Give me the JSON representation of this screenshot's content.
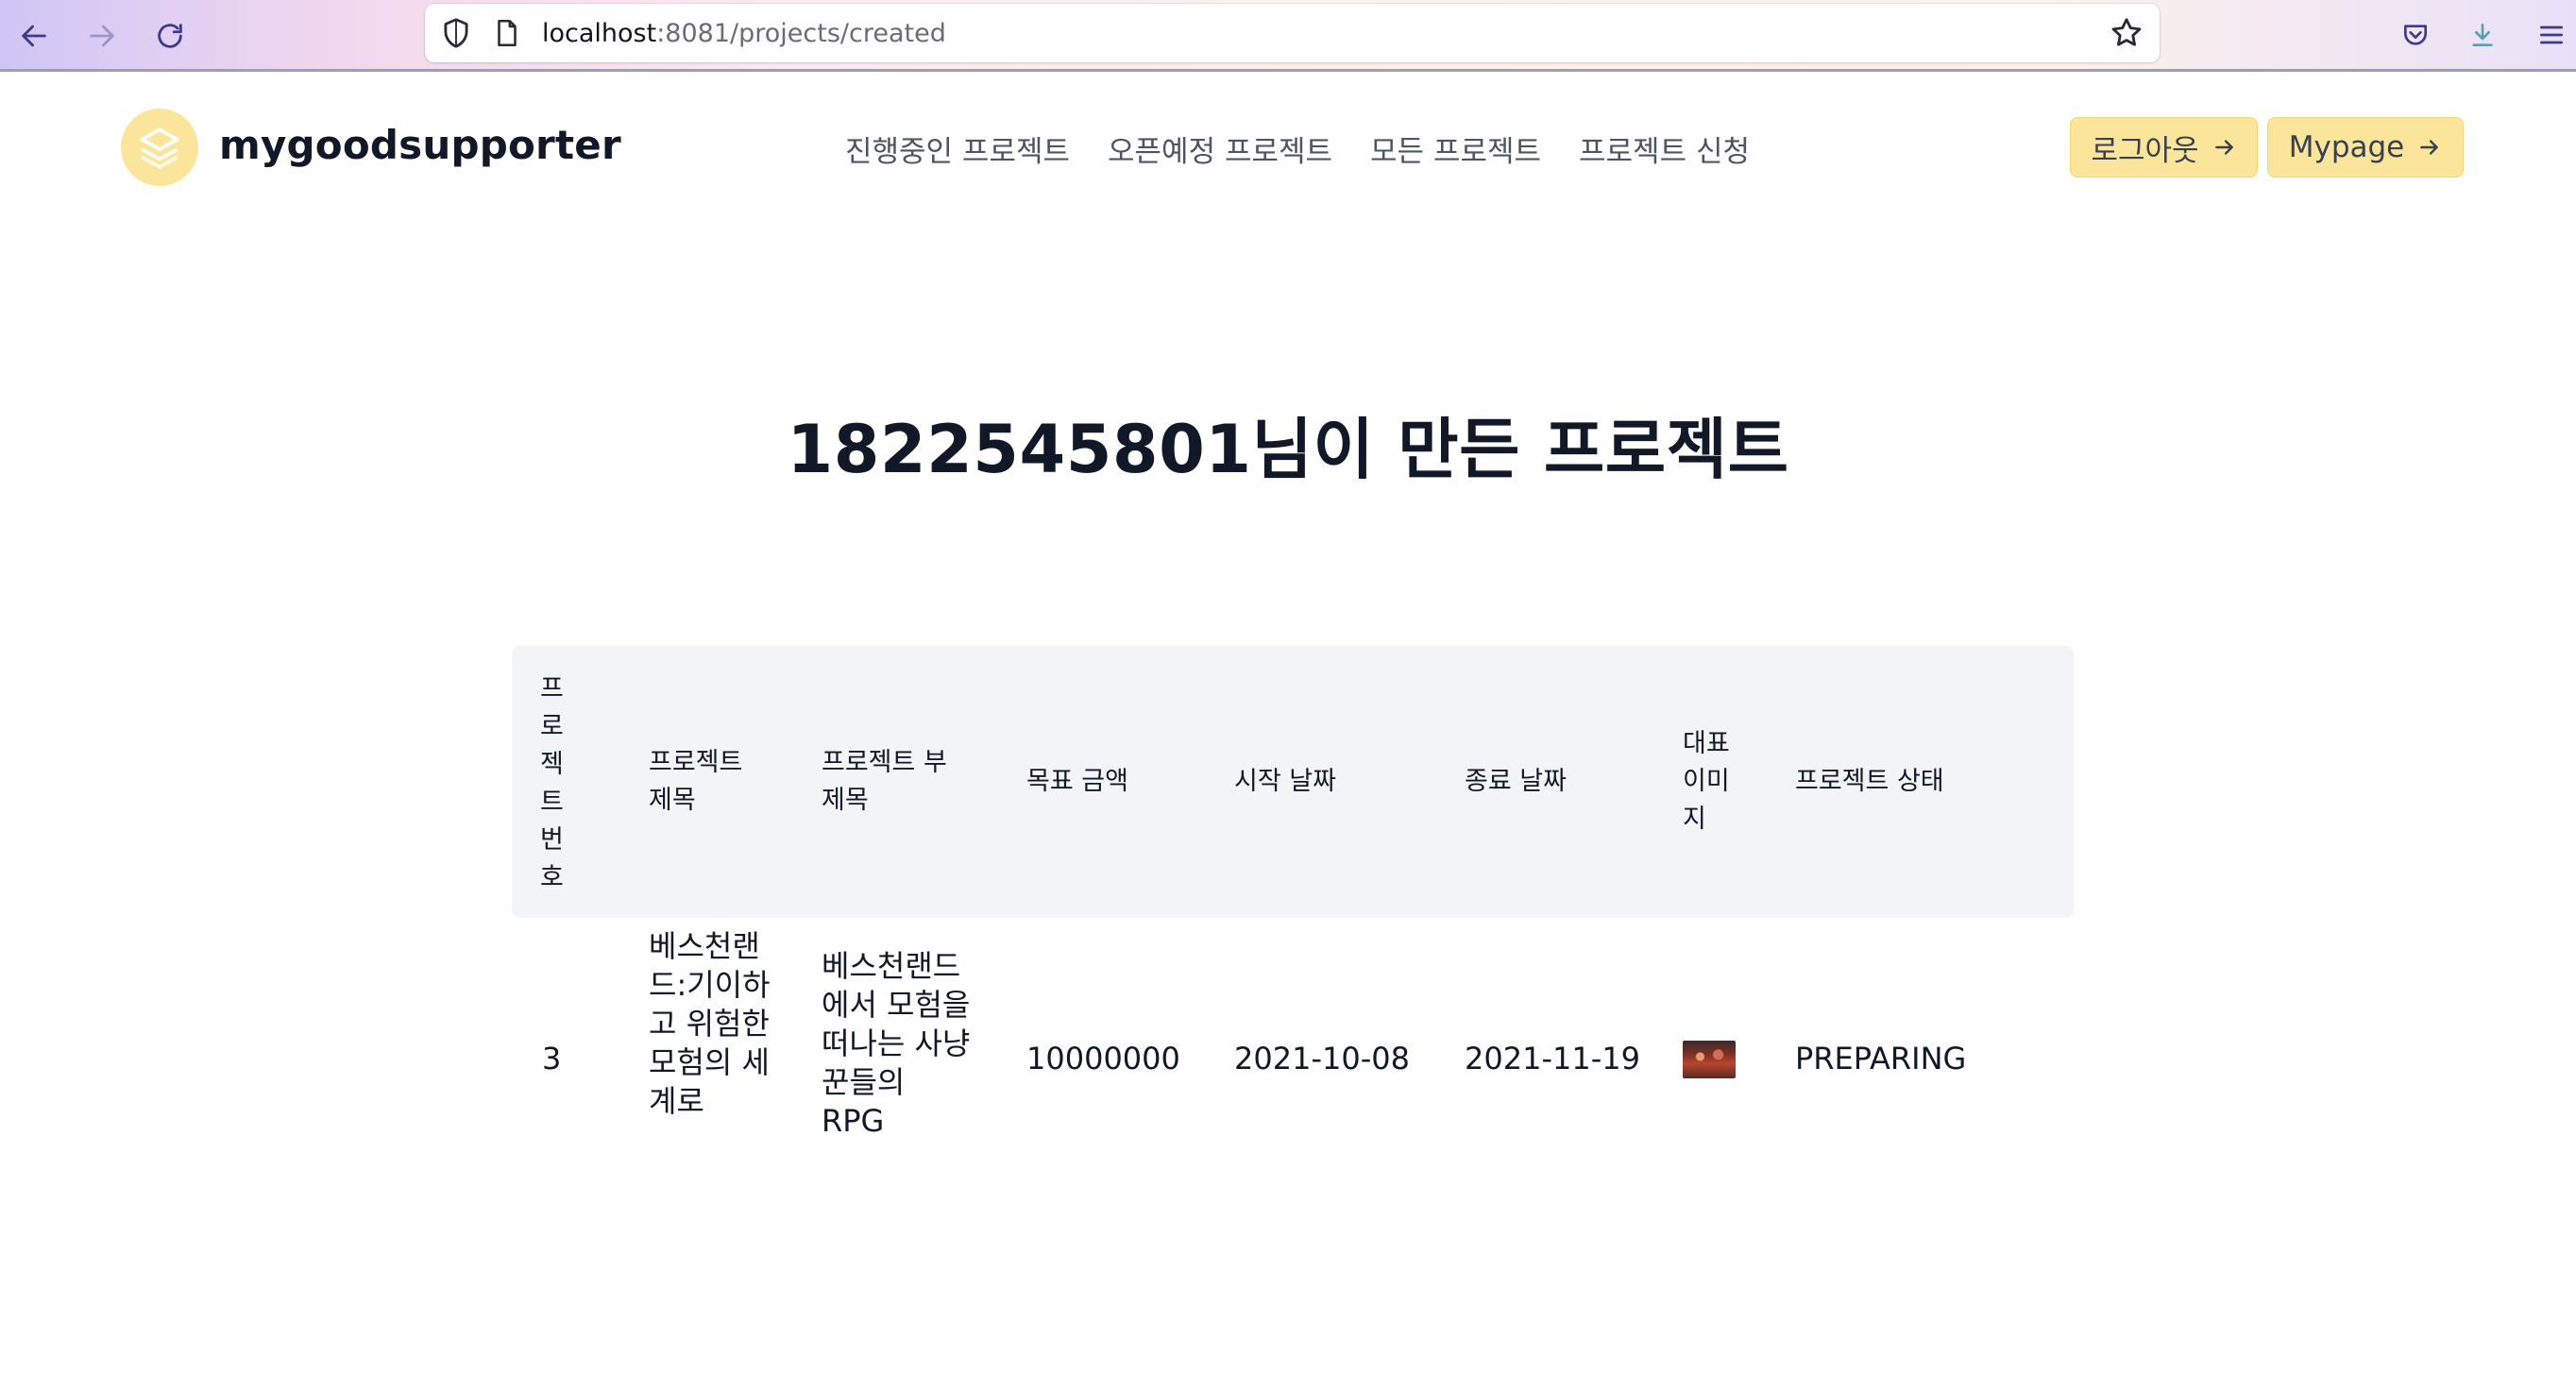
{
  "browser": {
    "url_host": "localhost",
    "url_path": ":8081/projects/created"
  },
  "header": {
    "brand": "mygoodsupporter",
    "nav": [
      "진행중인 프로젝트",
      "오픈예정 프로젝트",
      "모든 프로젝트",
      "프로젝트 신청"
    ],
    "logout_label": "로그아웃",
    "mypage_label": "Mypage"
  },
  "main": {
    "title": "1822545801님이 만든 프로젝트",
    "columns": {
      "number": "프로젝트번호",
      "title": "프로젝트 제목",
      "subtitle": "프로젝트 부 제목",
      "goal": "목표 금액",
      "start": "시작 날짜",
      "end": "종료 날짜",
      "image": "대표 이미지",
      "status": "프로젝트 상태"
    },
    "rows": [
      {
        "number": "3",
        "title": "베스천랜드:기이하고 위험한 모험의 세계로",
        "subtitle": "베스천랜드에서 모험을 떠나는 사냥꾼들의 RPG",
        "goal": "10000000",
        "start": "2021-10-08",
        "end": "2021-11-19",
        "status": "PREPARING"
      }
    ]
  },
  "colors": {
    "accent_yellow": "#fbe59b",
    "header_bg": "#f3f4f6",
    "text_dark": "#111827",
    "nav_gray": "#4b5563"
  }
}
